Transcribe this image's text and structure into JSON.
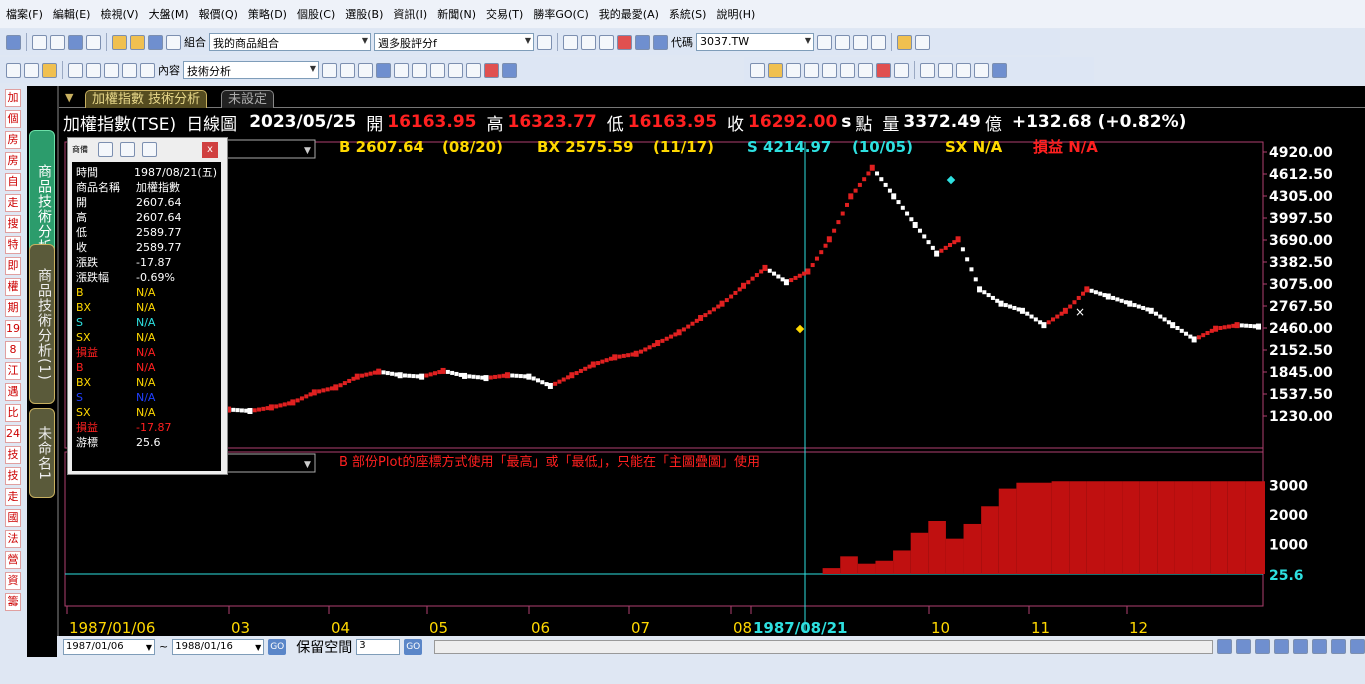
{
  "menu": [
    "檔案(F)",
    "編輯(E)",
    "檢視(V)",
    "大盤(M)",
    "報價(Q)",
    "策略(D)",
    "個股(C)",
    "選股(B)",
    "資訊(I)",
    "新聞(N)",
    "交易(T)",
    "勝率GO(C)",
    "我的最愛(A)",
    "系統(S)",
    "說明(H)"
  ],
  "toolbar": {
    "combo_label": "組合",
    "combo_value": "我的商品組合",
    "rating_value": "週多股評分f",
    "code_label": "代碼",
    "code_value": "3037.TW",
    "content_label": "內容",
    "content_value": "技術分析"
  },
  "sidebar_keys": [
    "加",
    "個",
    "房",
    "房",
    "自",
    "走",
    "搜",
    "特",
    "即",
    "權",
    "期",
    "19",
    "8",
    "江",
    "遇",
    "比",
    "24",
    "技",
    "技",
    "走",
    "國",
    "法",
    "營",
    "資",
    "籌"
  ],
  "vtabs": [
    "商品技術分析",
    "商品技術分析(1)",
    "未命名1"
  ],
  "tabs": [
    "加權指數 技術分析",
    "未設定"
  ],
  "info": {
    "name": "加權指數(TSE)",
    "period": "日線圖",
    "date": "2023/05/25",
    "open_label": "開",
    "open": "16163.95",
    "high_label": "高",
    "high": "16323.77",
    "low_label": "低",
    "low": "16163.95",
    "close_label": "收",
    "close": "16292.00",
    "s": "s",
    "point": "點",
    "vol_label": "量",
    "vol": "3372.49",
    "unit": "億",
    "change": "+132.68 (+0.82%)"
  },
  "signals": {
    "b": "B 2607.64",
    "b_date": "(08/20)",
    "bx": "BX 2575.59",
    "bx_date": "(11/17)",
    "s": "S 4214.97",
    "s_date": "(10/05)",
    "sx": "SX N/A",
    "pl": "損益 N/A"
  },
  "sub_note": "B 部份Plot的座標方式使用「最高」或「最低」，只能在「主圖疊圖」使用",
  "datapanel": {
    "title": "商備",
    "close_btn": "x",
    "rows": [
      {
        "k": "時間",
        "v": "1987/08/21(五)",
        "color": "#ffffff"
      },
      {
        "k": "商品名稱",
        "v": "加權指數",
        "color": "#ffffff"
      },
      {
        "k": "開",
        "v": "2607.64",
        "color": "#ffffff"
      },
      {
        "k": "高",
        "v": "2607.64",
        "color": "#ffffff"
      },
      {
        "k": "低",
        "v": "2589.77",
        "color": "#ffffff"
      },
      {
        "k": "收",
        "v": "2589.77",
        "color": "#ffffff"
      },
      {
        "k": "漲跌",
        "v": "-17.87",
        "color": "#ffffff"
      },
      {
        "k": "漲跌幅",
        "v": "-0.69%",
        "color": "#ffffff"
      },
      {
        "k": "B",
        "v": "N/A",
        "color": "#ffd800"
      },
      {
        "k": "BX",
        "v": "N/A",
        "color": "#ffd800"
      },
      {
        "k": "S",
        "v": "N/A",
        "color": "#2ee0e0"
      },
      {
        "k": "SX",
        "v": "N/A",
        "color": "#ffd800"
      },
      {
        "k": "損益",
        "v": "N/A",
        "color": "#ff2020"
      },
      {
        "k": "B",
        "v": "N/A",
        "color": "#ff2020"
      },
      {
        "k": "BX",
        "v": "N/A",
        "color": "#ffd800"
      },
      {
        "k": "S",
        "v": "N/A",
        "color": "#2040ff"
      },
      {
        "k": "SX",
        "v": "N/A",
        "color": "#ffd800"
      },
      {
        "k": "損益",
        "v": "-17.87",
        "color": "#ff2020"
      },
      {
        "k": "游標",
        "v": "25.6",
        "color": "#ffffff"
      }
    ]
  },
  "footer": {
    "date_from": "1987/01/06",
    "tilde": "~",
    "date_to": "1988/01/16",
    "go": "GO",
    "reserve_label": "保留空間",
    "reserve_value": "3",
    "go2": "GO"
  },
  "chart_data": {
    "type": "line",
    "main_y_ticks": [
      "4920.00",
      "4612.50",
      "4305.00",
      "3997.50",
      "3690.00",
      "3382.50",
      "3075.00",
      "2767.50",
      "2460.00",
      "2152.50",
      "1845.00",
      "1537.50",
      "1230.00"
    ],
    "main_ylim": [
      1230,
      4920
    ],
    "x_ticks": [
      "1987/01/06",
      "03",
      "04",
      "05",
      "06",
      "07",
      "08",
      "1987/08/21",
      "10",
      "11",
      "12"
    ],
    "series": [
      {
        "x": [
          0,
          5,
          10,
          15,
          20,
          25,
          30,
          35,
          40,
          45,
          50,
          55,
          60,
          65,
          70,
          75,
          80,
          85,
          90,
          95,
          100,
          105,
          110,
          115,
          120,
          125,
          130,
          135,
          140,
          145,
          150,
          155,
          160,
          165,
          170,
          175,
          180,
          185,
          190,
          195,
          200,
          205,
          210,
          215,
          220,
          225,
          230,
          235,
          240
        ],
        "values": [
          1320,
          1300,
          1350,
          1420,
          1560,
          1630,
          1780,
          1850,
          1800,
          1780,
          1860,
          1790,
          1760,
          1800,
          1780,
          1650,
          1800,
          1950,
          2050,
          2100,
          2250,
          2400,
          2600,
          2800,
          3050,
          3300,
          3100,
          3250,
          3700,
          4300,
          4700,
          4300,
          3900,
          3500,
          3700,
          3000,
          2800,
          2700,
          2500,
          2700,
          3000,
          2900,
          2800,
          2700,
          2500,
          2300,
          2450,
          2500,
          2480
        ]
      }
    ],
    "sub_y_ticks": [
      "3000",
      "2000",
      "1000"
    ],
    "sub_ylim": [
      0,
      3600
    ],
    "cursor_value": "25.6",
    "sub_series": {
      "x": [
        0,
        140,
        150,
        160,
        170,
        180,
        190,
        200,
        210,
        220,
        230,
        240,
        250,
        260,
        270,
        280,
        290,
        300,
        310,
        320,
        330,
        340,
        350,
        360,
        370,
        380,
        390,
        400
      ],
      "values": [
        0,
        0,
        200,
        600,
        350,
        450,
        800,
        1400,
        1800,
        1200,
        1700,
        2300,
        2900,
        3100,
        3100,
        3150,
        3150,
        3150,
        3150,
        3150,
        3150,
        3150,
        3150,
        3150,
        3150,
        3150,
        3150,
        3150
      ]
    }
  }
}
